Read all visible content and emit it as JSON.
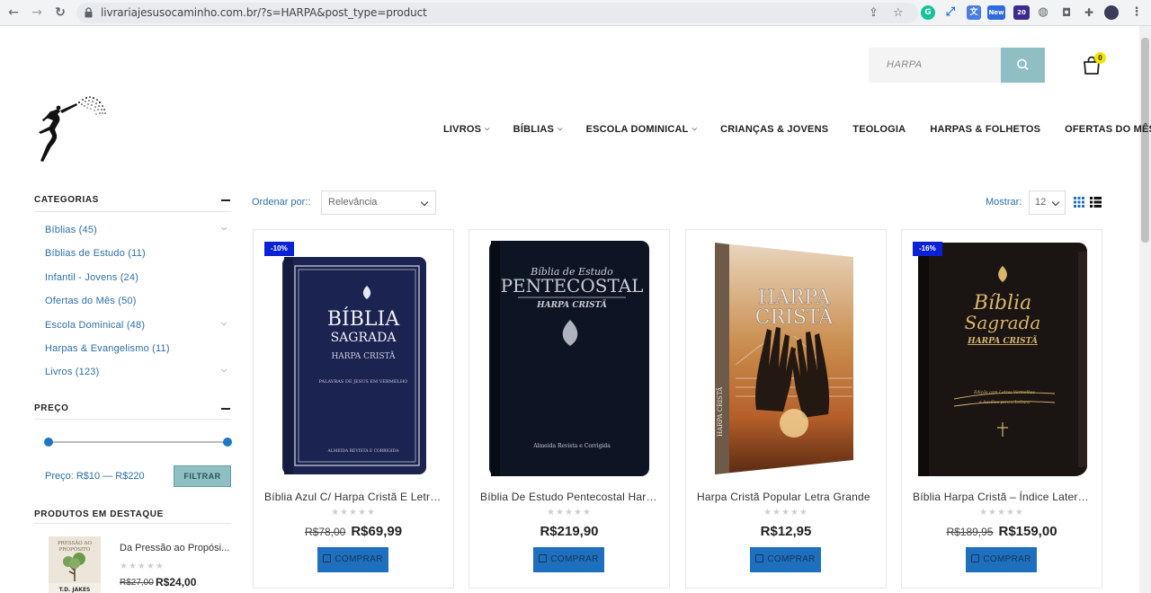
{
  "browser": {
    "url": "livrariajesusocaminho.com.br/?s=HARPA&post_type=product",
    "extension_badge_new": "New",
    "extension_badge_count": "20"
  },
  "header": {
    "search_value": "HARPA",
    "cart_count": "0"
  },
  "menu": [
    {
      "label": "LIVROS",
      "has_dropdown": true
    },
    {
      "label": "BÍBLIAS",
      "has_dropdown": true
    },
    {
      "label": "ESCOLA DOMINICAL",
      "has_dropdown": true
    },
    {
      "label": "CRIANÇAS & JOVENS",
      "has_dropdown": false
    },
    {
      "label": "TEOLOGIA",
      "has_dropdown": false
    },
    {
      "label": "HARPAS & FOLHETOS",
      "has_dropdown": false
    },
    {
      "label": "OFERTAS DO MÊS",
      "has_dropdown": false
    }
  ],
  "sidebar": {
    "categories_title": "CATEGORIAS",
    "categories": [
      {
        "label": "Bíblias (45)",
        "expandable": true
      },
      {
        "label": "Bíblias de Estudo (11)",
        "expandable": false
      },
      {
        "label": "Infantil - Jovens (24)",
        "expandable": false
      },
      {
        "label": "Ofertas do Mês (50)",
        "expandable": false
      },
      {
        "label": "Escola Dominical (48)",
        "expandable": true
      },
      {
        "label": "Harpas & Evangelismo (11)",
        "expandable": false
      },
      {
        "label": "Livros (123)",
        "expandable": true
      }
    ],
    "price_title": "PREÇO",
    "price_label": "Preço: R$10 — R$220",
    "filter_button": "FILTRAR",
    "featured_title": "PRODUTOS EM DESTAQUE",
    "featured": {
      "name": "Da Pressão ao Propósi...",
      "thumb_title": "PRESSÃO AO PROPÓSITO",
      "thumb_author": "T.D. JAKES",
      "stars": "★★★★★",
      "old_price": "R$27,00",
      "new_price": "R$24,00"
    }
  },
  "toolbar": {
    "sort_label": "Ordenar por::",
    "sort_value": "Relevância",
    "show_label": "Mostrar:",
    "show_value": "12"
  },
  "products": [
    {
      "badge": "-10%",
      "name": "Bíblia Azul C/ Harpa Cristã E Letra Grande",
      "stars": "★★★★★",
      "old_price": "R$78,00",
      "price": "R$69,99",
      "buy_label": "COMPRAR",
      "cover": {
        "line1": "BÍBLIA",
        "line2": "SAGRADA",
        "line3": "HARPA CRISTÃ",
        "line4": "PALAVRAS DE JESUS EM VERMELHO",
        "footer": "ALMEIDA REVISTA E CORRIGIDA",
        "color": "#1b2350"
      }
    },
    {
      "badge": "",
      "name": "Bíblia De Estudo Pentecostal Harpa Cristã",
      "stars": "★★★★★",
      "old_price": "",
      "price": "R$219,90",
      "buy_label": "COMPRAR",
      "cover": {
        "line1": "Bíblia de Estudo",
        "line2": "PENTECOSTAL",
        "line3": "HARPA CRISTÃ",
        "footer": "Almeida Revista e Corrigida",
        "color": "#0d1424"
      }
    },
    {
      "badge": "",
      "name": "Harpa Cristã Popular Letra Grande",
      "stars": "★★★★★",
      "old_price": "",
      "price": "R$12,95",
      "buy_label": "COMPRAR",
      "cover": {
        "line1": "HARPA",
        "line2": "CRISTÃ",
        "spine": "HARPA CRISTÃ",
        "color": "#d8803a"
      }
    },
    {
      "badge": "-16%",
      "name": "Bíblia Harpa Cristã – Índice Lateral Letra Gigante",
      "stars": "★★★★★",
      "old_price": "R$189,95",
      "price": "R$159,00",
      "buy_label": "COMPRAR",
      "cover": {
        "line1": "Bíblia",
        "line2": "Sagrada",
        "line3": "HARPA CRISTÃ",
        "line4": "Edição com Letras Vermelhas",
        "line5": "e Auxílios para a Leitura",
        "color": "#1a1412"
      }
    }
  ]
}
